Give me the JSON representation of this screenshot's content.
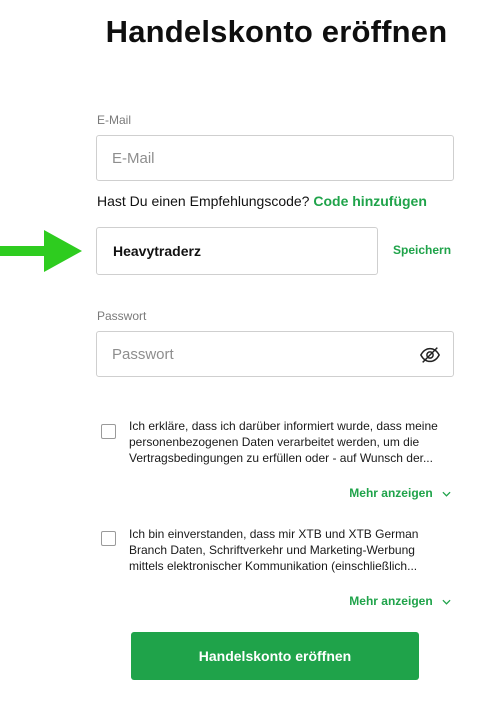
{
  "title": "Handelskonto eröffnen",
  "email": {
    "label": "E-Mail",
    "placeholder": "E-Mail",
    "value": ""
  },
  "referral": {
    "question": "Hast Du einen Empfehlungscode?",
    "add_link": "Code hinzufügen",
    "code_value": "Heavytraderz",
    "save_label": "Speichern"
  },
  "password": {
    "label": "Passwort",
    "placeholder": "Passwort",
    "value": "",
    "toggle_icon": "eye-slash-icon"
  },
  "consents": [
    {
      "text": "Ich erkläre, dass ich darüber informiert wurde, dass meine personenbezogenen Daten verarbeitet werden, um die Vertragsbedingungen zu erfüllen oder - auf Wunsch der...",
      "checked": false,
      "more_label": "Mehr anzeigen"
    },
    {
      "text": "Ich bin einverstanden, dass mir XTB und XTB German Branch Daten, Schriftverkehr und Marketing-Werbung mittels elektronischer Kommunikation (einschließlich...",
      "checked": false,
      "more_label": "Mehr anzeigen"
    }
  ],
  "submit_label": "Handelskonto eröffnen",
  "colors": {
    "accent": "#1fa34a",
    "arrow": "#2ecc1f",
    "border": "#cfcfcf"
  }
}
